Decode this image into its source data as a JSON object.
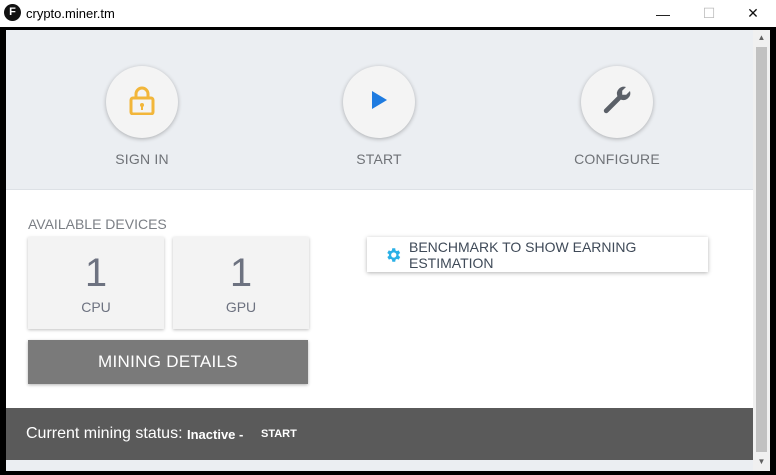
{
  "window": {
    "title": "crypto.miner.tm",
    "app_icon_letter": "F",
    "minimize_glyph": "—",
    "maximize_glyph": "☐",
    "close_glyph": "✕"
  },
  "actions": [
    {
      "label": "SIGN IN",
      "icon": "lock-icon",
      "color": "#f2b63a"
    },
    {
      "label": "START",
      "icon": "play-icon",
      "color": "#1e7be0"
    },
    {
      "label": "CONFIGURE",
      "icon": "wrench-icon",
      "color": "#5b6068"
    }
  ],
  "devices": {
    "heading": "AVAILABLE DEVICES",
    "items": [
      {
        "count": "1",
        "name": "CPU"
      },
      {
        "count": "1",
        "name": "GPU"
      }
    ]
  },
  "mining_details_label": "MINING DETAILS",
  "benchmark": {
    "label": "BENCHMARK TO SHOW EARNING ESTIMATION",
    "icon": "gear-icon",
    "icon_color": "#2ab0e6"
  },
  "status": {
    "label": "Current mining status:",
    "value": "Inactive -",
    "action": "START"
  },
  "colors": {
    "status_bar": "#5a5a5a",
    "mining_button": "#7a7a7a",
    "header_bg": "#ebeef2"
  }
}
